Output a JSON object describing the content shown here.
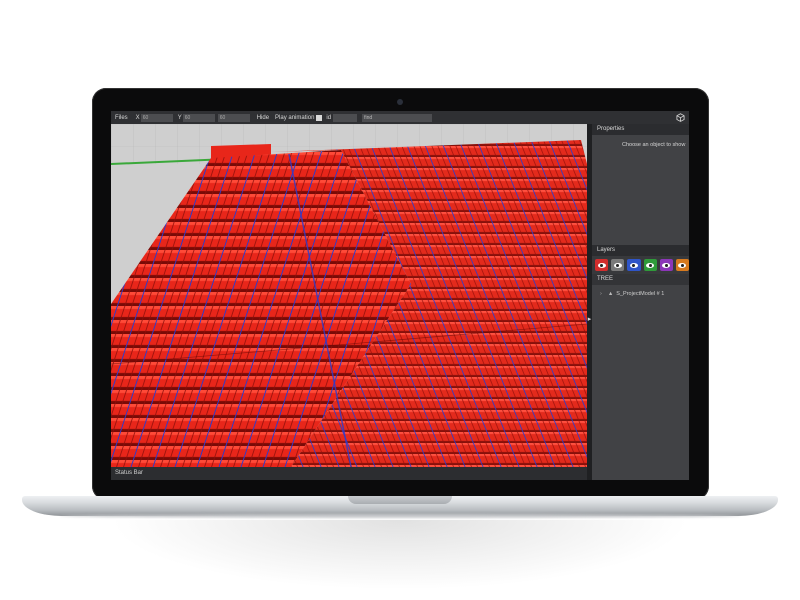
{
  "toolbar": {
    "files_label": "Files",
    "x_label": "X",
    "x_value": "60",
    "y_label": "Y",
    "y_value": "60",
    "z_value": "60",
    "hide_label": "Hide",
    "play_animation_label": "Play animation",
    "id_label": "id",
    "find_placeholder": "find"
  },
  "properties": {
    "header": "Properties",
    "hint": "Choose an object to show"
  },
  "layers": {
    "header": "Layers",
    "buttons": [
      {
        "icon": "eye-icon",
        "color": "#d22d2d"
      },
      {
        "icon": "eye-icon",
        "color": "#7a7a7a"
      },
      {
        "icon": "eye-icon",
        "color": "#2f55c8"
      },
      {
        "icon": "eye-icon",
        "color": "#2f9a3a"
      },
      {
        "icon": "eye-icon",
        "color": "#8b36b8"
      },
      {
        "icon": "eye-icon",
        "color": "#d77a1e"
      }
    ]
  },
  "tree": {
    "header": "TREE",
    "items": [
      {
        "label": "S_ProjectModel # 1",
        "icon": "model-icon"
      }
    ]
  },
  "status_bar": {
    "text": "Status Bar"
  },
  "colors": {
    "panel_module": "#e8261a",
    "mullion": "#2a3ccf",
    "ground": "#cfcfcf",
    "ui_dark": "#2f3033"
  }
}
